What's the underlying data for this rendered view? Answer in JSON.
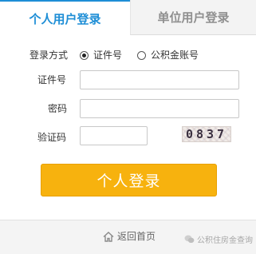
{
  "tabs": {
    "personal": "个人用户登录",
    "unit": "单位用户登录"
  },
  "form": {
    "login_method_label": "登录方式",
    "options": [
      "证件号",
      "公积金账号"
    ],
    "selected_option": "证件号",
    "id_label": "证件号",
    "id_value": "",
    "password_label": "密码",
    "password_value": "",
    "captcha_label": "验证码",
    "captcha_value": "",
    "captcha_code": "0837"
  },
  "login_button": "个人登录",
  "footer": {
    "home_link": "返回首页",
    "watermark": "公积住房金查询"
  },
  "colors": {
    "accent": "#1e8ed6",
    "button": "#f7b20e"
  },
  "icons": {
    "home": "home-icon",
    "watermark": "wechat-icon"
  }
}
